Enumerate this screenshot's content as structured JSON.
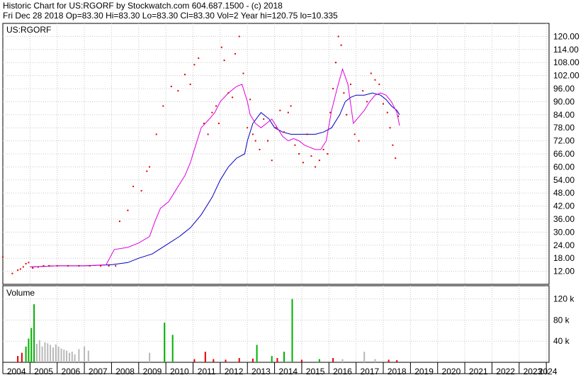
{
  "header": {
    "line1": "Historic Chart for US:RGORF by Stockwatch.com 604.687.1500 - (c) 2018",
    "line2": "Fri Dec 28 2018   Op=83.30  Hi=83.30  Lo=83.30  Cl=83.30  Vol=2  Year hi=120.75  lo=10.335"
  },
  "colors": {
    "price_dots": "#e00000",
    "ma_short": "#e000e0",
    "ma_long": "#0000c0",
    "volume_gray": "#b8b8b8",
    "volume_green": "#00b000",
    "volume_red": "#e00000",
    "grid": "#c8c8c8"
  },
  "chart_data": [
    {
      "type": "line",
      "title": "US:RGORF",
      "ylim": [
        6,
        126
      ],
      "y_ticks": [
        12.0,
        18.0,
        24.0,
        30.0,
        36.0,
        42.0,
        48.0,
        54.0,
        60.0,
        66.0,
        72.0,
        78.0,
        84.0,
        90.0,
        96.0,
        102.0,
        108.0,
        114.0,
        120.0
      ],
      "y_tick_labels": [
        "12.00",
        "18.00",
        "24.00",
        "30.00",
        "36.00",
        "42.00",
        "48.00",
        "54.00",
        "60.00",
        "66.00",
        "72.00",
        "78.00",
        "84.00",
        "90.00",
        "96.00",
        "102.00",
        "108.00",
        "114.00",
        "120.00"
      ],
      "x_ticks": [
        "2004",
        "2005",
        "2006",
        "2007",
        "2008",
        "2009",
        "2010",
        "2011",
        "2012",
        "2013",
        "2014",
        "2015",
        "2016",
        "2017",
        "2018",
        "2019",
        "2020",
        "2021",
        "2022",
        "2023",
        "2024"
      ],
      "xlim": [
        2004.0,
        2024.1
      ],
      "grid": true,
      "series": [
        {
          "style": "dots",
          "color_key": "price_dots",
          "x": [
            2004.0,
            2004.35,
            2004.55,
            2004.65,
            2004.75,
            2004.85,
            2004.95,
            2005.1,
            2005.3,
            2005.5,
            2005.7,
            2006.0,
            2006.4,
            2006.8,
            2007.2,
            2007.6,
            2007.9,
            2008.15,
            2008.3,
            2008.6,
            2008.8,
            2009.1,
            2009.3,
            2009.4,
            2009.65,
            2009.9,
            2010.2,
            2010.45,
            2010.7,
            2010.9,
            2011.05,
            2011.2,
            2011.4,
            2011.55,
            2011.7,
            2011.85,
            2011.95,
            2012.05,
            2012.15,
            2012.3,
            2012.45,
            2012.55,
            2012.7,
            2012.85,
            2013.0,
            2013.1,
            2013.2,
            2013.3,
            2013.45,
            2013.6,
            2013.75,
            2013.9,
            2014.05,
            2014.2,
            2014.35,
            2014.5,
            2014.6,
            2014.75,
            2014.9,
            2015.05,
            2015.2,
            2015.35,
            2015.5,
            2015.65,
            2015.8,
            2015.95,
            2016.05,
            2016.15,
            2016.25,
            2016.35,
            2016.45,
            2016.55,
            2016.65,
            2016.8,
            2016.95,
            2017.1,
            2017.25,
            2017.4,
            2017.55,
            2017.7,
            2017.85,
            2018.0,
            2018.15,
            2018.25,
            2018.35,
            2018.45,
            2018.55
          ],
          "y": [
            18.5,
            11.0,
            12.5,
            13.0,
            14.0,
            15.5,
            16.0,
            13.5,
            14.0,
            14.5,
            14.5,
            14.5,
            14.5,
            14.5,
            14.5,
            14.5,
            14.5,
            14.5,
            35.0,
            40.0,
            51.0,
            49.0,
            58.0,
            60.0,
            75.0,
            88.0,
            97.0,
            95.0,
            102.5,
            98.0,
            107.0,
            110.0,
            80.0,
            75.0,
            85.0,
            88.0,
            80.0,
            115.0,
            109.0,
            94.0,
            92.0,
            112.0,
            120.0,
            103.0,
            78.0,
            91.0,
            75.0,
            72.0,
            68.0,
            82.0,
            72.0,
            63.0,
            78.0,
            86.0,
            76.0,
            85.0,
            88.0,
            70.0,
            66.0,
            62.0,
            75.0,
            65.0,
            60.0,
            63.0,
            68.0,
            66.0,
            85.0,
            96.0,
            108.0,
            120.0,
            116.0,
            94.0,
            84.0,
            98.0,
            75.0,
            72.0,
            95.0,
            90.0,
            103.0,
            100.0,
            98.0,
            89.0,
            85.0,
            78.0,
            70.0,
            64.0,
            83.3
          ]
        },
        {
          "name": "",
          "style": "line",
          "color_key": "ma_short",
          "x": [
            2005.0,
            2006.0,
            2007.0,
            2007.8,
            2008.1,
            2008.6,
            2009.0,
            2009.4,
            2009.6,
            2009.8,
            2010.1,
            2010.3,
            2010.5,
            2010.7,
            2010.9,
            2011.1,
            2011.3,
            2011.6,
            2011.8,
            2012.0,
            2012.3,
            2012.6,
            2012.8,
            2013.0,
            2013.1,
            2013.3,
            2013.5,
            2013.7,
            2013.9,
            2014.1,
            2014.3,
            2014.5,
            2014.7,
            2014.9,
            2015.1,
            2015.3,
            2015.5,
            2015.7,
            2015.9,
            2016.1,
            2016.3,
            2016.5,
            2016.7,
            2016.9,
            2017.1,
            2017.3,
            2017.5,
            2017.7,
            2017.9,
            2018.1,
            2018.3,
            2018.5,
            2018.6
          ],
          "y": [
            14.0,
            14.5,
            14.5,
            15.0,
            22.0,
            23.0,
            25.0,
            28.0,
            35.0,
            41.0,
            44.0,
            48.0,
            52.0,
            56.0,
            62.0,
            70.0,
            78.0,
            82.0,
            85.0,
            90.0,
            94.0,
            97.0,
            98.0,
            90.0,
            84.0,
            80.0,
            78.0,
            80.0,
            82.0,
            78.0,
            74.0,
            72.0,
            73.0,
            72.0,
            70.0,
            69.0,
            68.0,
            68.0,
            72.0,
            86.0,
            96.0,
            105.0,
            98.0,
            80.0,
            83.0,
            86.0,
            90.0,
            93.0,
            94.0,
            93.0,
            90.0,
            85.0,
            79.0
          ]
        },
        {
          "name": "",
          "style": "line",
          "color_key": "ma_long",
          "x": [
            2005.0,
            2006.0,
            2007.0,
            2008.0,
            2008.6,
            2009.0,
            2009.5,
            2010.0,
            2010.5,
            2010.9,
            2011.3,
            2011.7,
            2012.0,
            2012.3,
            2012.6,
            2012.9,
            2013.0,
            2013.2,
            2013.5,
            2013.8,
            2014.0,
            2014.3,
            2014.6,
            2014.9,
            2015.2,
            2015.5,
            2015.8,
            2016.1,
            2016.4,
            2016.6,
            2016.8,
            2017.0,
            2017.3,
            2017.6,
            2017.9,
            2018.1,
            2018.3,
            2018.5,
            2018.6
          ],
          "y": [
            14.0,
            14.5,
            14.5,
            15.0,
            16.0,
            18.0,
            20.0,
            24.0,
            28.0,
            32.0,
            38.0,
            46.0,
            54.0,
            60.0,
            64.0,
            66.0,
            72.0,
            80.0,
            85.0,
            82.0,
            78.0,
            76.0,
            75.0,
            75.0,
            75.0,
            75.0,
            76.0,
            78.0,
            84.0,
            90.0,
            92.0,
            93.0,
            93.0,
            94.0,
            93.0,
            91.0,
            88.0,
            86.0,
            84.0
          ]
        }
      ]
    },
    {
      "type": "bar",
      "title": "Volume",
      "ylim": [
        0,
        145000
      ],
      "y_ticks": [
        40000,
        80000,
        120000
      ],
      "y_tick_labels": [
        "40 k",
        "80 k",
        "120 k"
      ],
      "grid": true,
      "bars": [
        {
          "x": 2004.55,
          "v": 12000,
          "c": "volume_red"
        },
        {
          "x": 2004.7,
          "v": 18000,
          "c": "volume_red"
        },
        {
          "x": 2004.85,
          "v": 30000,
          "c": "volume_green"
        },
        {
          "x": 2004.95,
          "v": 45000,
          "c": "volume_green"
        },
        {
          "x": 2005.05,
          "v": 65000,
          "c": "volume_green"
        },
        {
          "x": 2005.15,
          "v": 110000,
          "c": "volume_green"
        },
        {
          "x": 2005.25,
          "v": 35000,
          "c": "volume_gray"
        },
        {
          "x": 2005.35,
          "v": 42000,
          "c": "volume_gray"
        },
        {
          "x": 2005.45,
          "v": 30000,
          "c": "volume_gray"
        },
        {
          "x": 2005.55,
          "v": 38000,
          "c": "volume_gray"
        },
        {
          "x": 2005.65,
          "v": 36000,
          "c": "volume_gray"
        },
        {
          "x": 2005.75,
          "v": 33000,
          "c": "volume_gray"
        },
        {
          "x": 2005.85,
          "v": 28000,
          "c": "volume_gray"
        },
        {
          "x": 2005.95,
          "v": 34000,
          "c": "volume_gray"
        },
        {
          "x": 2006.05,
          "v": 30000,
          "c": "volume_gray"
        },
        {
          "x": 2006.15,
          "v": 26000,
          "c": "volume_gray"
        },
        {
          "x": 2006.25,
          "v": 24000,
          "c": "volume_gray"
        },
        {
          "x": 2006.35,
          "v": 22000,
          "c": "volume_gray"
        },
        {
          "x": 2006.45,
          "v": 18000,
          "c": "volume_gray"
        },
        {
          "x": 2006.55,
          "v": 20000,
          "c": "volume_gray"
        },
        {
          "x": 2006.65,
          "v": 15000,
          "c": "volume_gray"
        },
        {
          "x": 2006.8,
          "v": 25000,
          "c": "volume_gray"
        },
        {
          "x": 2007.0,
          "v": 30000,
          "c": "volume_gray"
        },
        {
          "x": 2007.15,
          "v": 22000,
          "c": "volume_gray"
        },
        {
          "x": 2009.4,
          "v": 18000,
          "c": "volume_gray"
        },
        {
          "x": 2009.95,
          "v": 75000,
          "c": "volume_green"
        },
        {
          "x": 2010.25,
          "v": 52000,
          "c": "volume_green"
        },
        {
          "x": 2011.05,
          "v": 6000,
          "c": "volume_red"
        },
        {
          "x": 2011.45,
          "v": 20000,
          "c": "volume_red"
        },
        {
          "x": 2011.75,
          "v": 6000,
          "c": "volume_red"
        },
        {
          "x": 2012.2,
          "v": 5000,
          "c": "volume_red"
        },
        {
          "x": 2012.7,
          "v": 8000,
          "c": "volume_red"
        },
        {
          "x": 2013.2,
          "v": 7000,
          "c": "volume_red"
        },
        {
          "x": 2013.35,
          "v": 33000,
          "c": "volume_green"
        },
        {
          "x": 2013.9,
          "v": 12000,
          "c": "volume_green"
        },
        {
          "x": 2014.1,
          "v": 8000,
          "c": "volume_red"
        },
        {
          "x": 2014.35,
          "v": 20000,
          "c": "volume_green"
        },
        {
          "x": 2014.65,
          "v": 120000,
          "c": "volume_green"
        },
        {
          "x": 2015.0,
          "v": 5000,
          "c": "volume_red"
        },
        {
          "x": 2015.65,
          "v": 6000,
          "c": "volume_green"
        },
        {
          "x": 2016.15,
          "v": 8000,
          "c": "volume_red"
        },
        {
          "x": 2016.5,
          "v": 6000,
          "c": "volume_gray"
        },
        {
          "x": 2017.3,
          "v": 20000,
          "c": "volume_gray"
        },
        {
          "x": 2017.7,
          "v": 6000,
          "c": "volume_gray"
        },
        {
          "x": 2018.2,
          "v": 5000,
          "c": "volume_red"
        },
        {
          "x": 2018.5,
          "v": 4000,
          "c": "volume_red"
        }
      ]
    }
  ]
}
